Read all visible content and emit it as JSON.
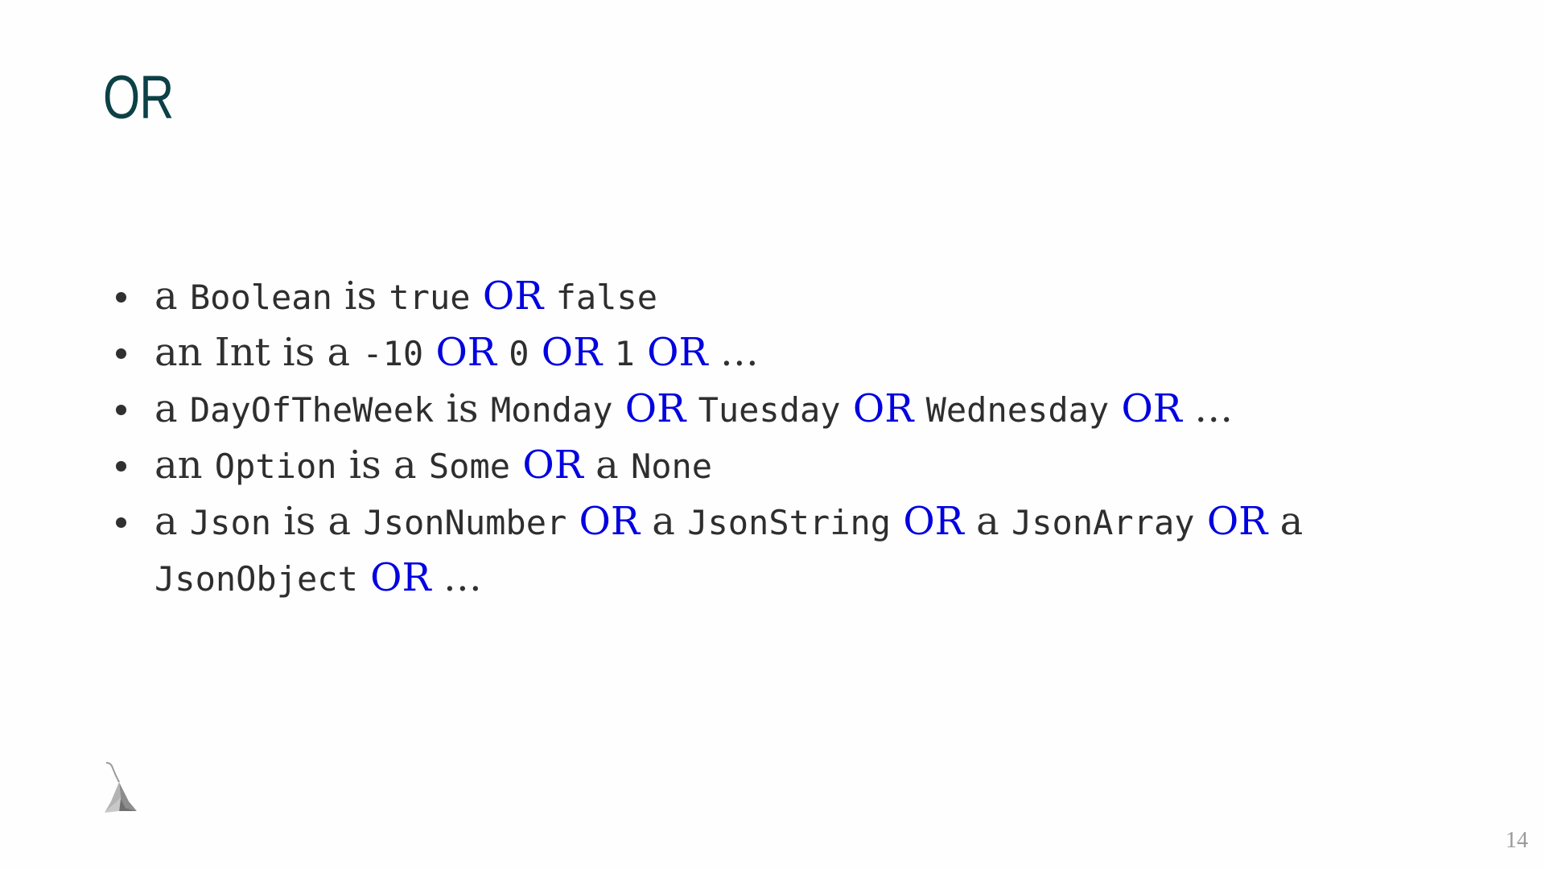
{
  "slide": {
    "title": "OR",
    "page_number": "14",
    "logo_icon": "lambda-logo-icon"
  },
  "colors": {
    "title": "#0c4146",
    "text": "#303030",
    "or_highlight": "#0000e0",
    "page_number": "#9a9a9a"
  },
  "bullets": [
    [
      {
        "style": "t",
        "text": "a "
      },
      {
        "style": "kw",
        "text": "Boolean"
      },
      {
        "style": "t",
        "text": " is "
      },
      {
        "style": "kw",
        "text": "true"
      },
      {
        "style": "t",
        "text": " "
      },
      {
        "style": "or",
        "text": "OR"
      },
      {
        "style": "t",
        "text": " "
      },
      {
        "style": "kw",
        "text": "false"
      }
    ],
    [
      {
        "style": "t",
        "text": "an Int is a "
      },
      {
        "style": "kw",
        "text": "-10"
      },
      {
        "style": "t",
        "text": " "
      },
      {
        "style": "or",
        "text": "OR"
      },
      {
        "style": "t",
        "text": " "
      },
      {
        "style": "kw",
        "text": "0"
      },
      {
        "style": "t",
        "text": " "
      },
      {
        "style": "or",
        "text": "OR"
      },
      {
        "style": "t",
        "text": " "
      },
      {
        "style": "kw",
        "text": "1"
      },
      {
        "style": "t",
        "text": " "
      },
      {
        "style": "or",
        "text": "OR"
      },
      {
        "style": "t",
        "text": " …"
      }
    ],
    [
      {
        "style": "t",
        "text": "a "
      },
      {
        "style": "kw",
        "text": "DayOfTheWeek"
      },
      {
        "style": "t",
        "text": " is "
      },
      {
        "style": "kw",
        "text": "Monday"
      },
      {
        "style": "t",
        "text": " "
      },
      {
        "style": "or",
        "text": "OR"
      },
      {
        "style": "t",
        "text": " "
      },
      {
        "style": "kw",
        "text": "Tuesday"
      },
      {
        "style": "t",
        "text": " "
      },
      {
        "style": "or",
        "text": "OR"
      },
      {
        "style": "t",
        "text": " "
      },
      {
        "style": "kw",
        "text": "Wednesday"
      },
      {
        "style": "t",
        "text": " "
      },
      {
        "style": "or",
        "text": "OR"
      },
      {
        "style": "t",
        "text": " …"
      }
    ],
    [
      {
        "style": "t",
        "text": "an "
      },
      {
        "style": "kw",
        "text": "Option"
      },
      {
        "style": "t",
        "text": " is a "
      },
      {
        "style": "kw",
        "text": "Some"
      },
      {
        "style": "t",
        "text": " "
      },
      {
        "style": "or",
        "text": "OR"
      },
      {
        "style": "t",
        "text": " a "
      },
      {
        "style": "kw",
        "text": "None"
      }
    ],
    [
      {
        "style": "t",
        "text": "a "
      },
      {
        "style": "kw",
        "text": "Json"
      },
      {
        "style": "t",
        "text": " is a "
      },
      {
        "style": "kw",
        "text": "JsonNumber"
      },
      {
        "style": "t",
        "text": " "
      },
      {
        "style": "or",
        "text": "OR"
      },
      {
        "style": "t",
        "text": " a "
      },
      {
        "style": "kw",
        "text": "JsonString"
      },
      {
        "style": "t",
        "text": " "
      },
      {
        "style": "or",
        "text": "OR"
      },
      {
        "style": "t",
        "text": " a "
      },
      {
        "style": "kw",
        "text": "JsonArray"
      },
      {
        "style": "t",
        "text": " "
      },
      {
        "style": "or",
        "text": "OR"
      },
      {
        "style": "t",
        "text": " a "
      },
      {
        "style": "kw",
        "text": "JsonObject"
      },
      {
        "style": "t",
        "text": " "
      },
      {
        "style": "or",
        "text": "OR"
      },
      {
        "style": "t",
        "text": " …"
      }
    ]
  ]
}
